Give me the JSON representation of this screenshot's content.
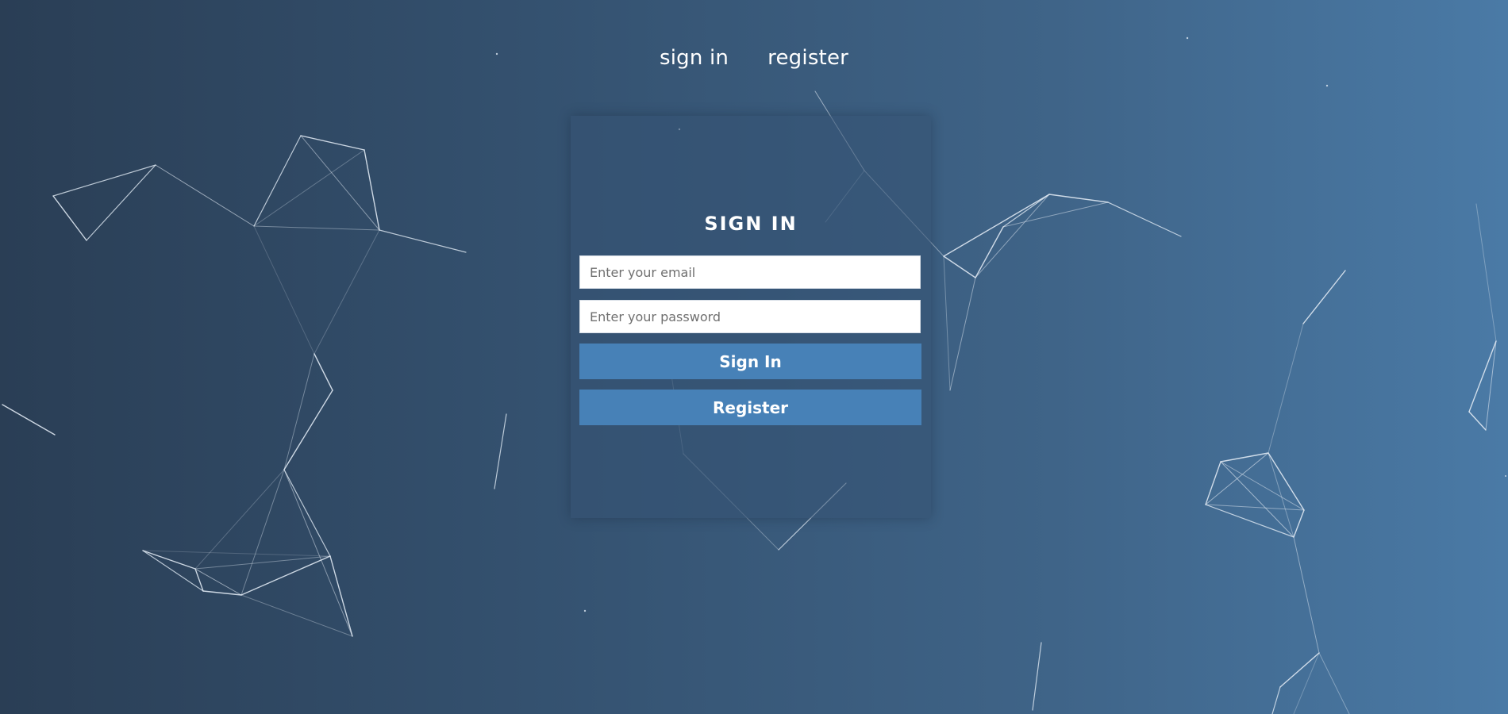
{
  "nav": {
    "sign_in_label": "sign in",
    "register_label": "register"
  },
  "form": {
    "title": "SIGN IN",
    "email_placeholder": "Enter your email",
    "password_placeholder": "Enter your password",
    "sign_in_button": "Sign In",
    "register_button": "Register"
  },
  "colors": {
    "background_start": "#2a3e55",
    "background_end": "#4a7aa6",
    "button": "#4781b7",
    "text": "#ffffff"
  }
}
